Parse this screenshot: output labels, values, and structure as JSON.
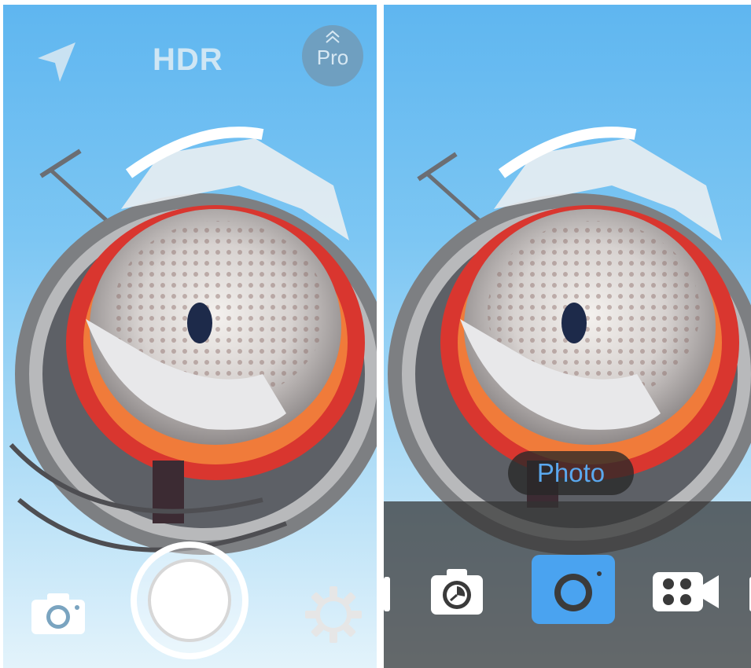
{
  "left_screen": {
    "top_bar": {
      "location_icon": "location-arrow-icon",
      "hdr_label": "HDR",
      "pro_label": "Pro",
      "pro_chevron_icon": "double-chevron-up-icon"
    },
    "bottom_bar": {
      "camera_icon": "camera-icon",
      "shutter_icon": "shutter-button",
      "settings_icon": "gear-icon"
    }
  },
  "right_screen": {
    "mode_label": "Photo",
    "modes": [
      {
        "name": "partial",
        "icon": "partial-mode-icon"
      },
      {
        "name": "timer",
        "icon": "timer-camera-icon"
      },
      {
        "name": "photo",
        "icon": "camera-icon",
        "selected": true
      },
      {
        "name": "video",
        "icon": "video-camera-icon"
      },
      {
        "name": "partial",
        "icon": "partial-mode-icon"
      }
    ]
  },
  "colors": {
    "selected_mode": "#4aa3f0",
    "sky": "#7cc6f3",
    "dock": "#323232"
  }
}
